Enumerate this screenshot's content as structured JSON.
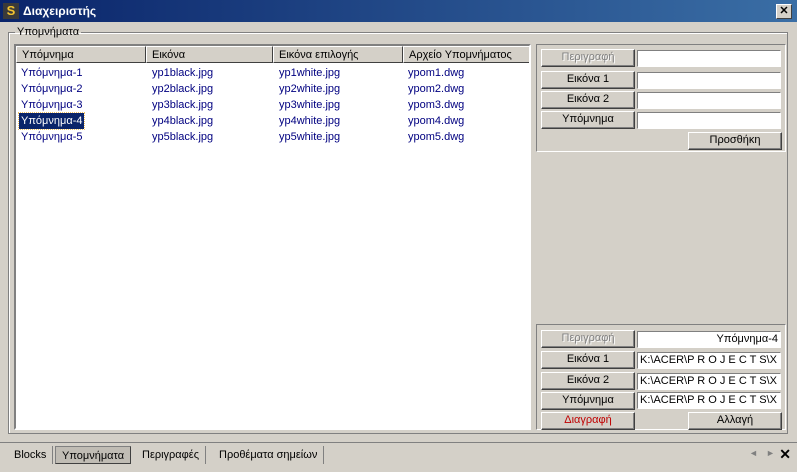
{
  "window": {
    "title": "Διαχειριστής",
    "close_glyph": "✕"
  },
  "group": {
    "legend": "Υπομνήματα"
  },
  "list": {
    "columns": [
      "Υπόμνημα",
      "Εικόνα",
      "Εικόνα επιλογής",
      "Αρχείο Υπομνήματος"
    ],
    "rows": [
      [
        "Υπόμνημα-1",
        "yp1black.jpg",
        "yp1white.jpg",
        "ypom1.dwg"
      ],
      [
        "Υπόμνημα-2",
        "yp2black.jpg",
        "yp2white.jpg",
        "ypom2.dwg"
      ],
      [
        "Υπόμνημα-3",
        "yp3black.jpg",
        "yp3white.jpg",
        "ypom3.dwg"
      ],
      [
        "Υπόμνημα-4",
        "yp4black.jpg",
        "yp4white.jpg",
        "ypom4.dwg"
      ],
      [
        "Υπόμνημα-5",
        "yp5black.jpg",
        "yp5white.jpg",
        "ypom5.dwg"
      ]
    ],
    "selected_label": "Υπόμνημα-4"
  },
  "add_panel": {
    "description_label": "Περιγραφή",
    "image1_label": "Εικόνα 1",
    "image2_label": "Εικόνα 2",
    "legend_label": "Υπόμνημα",
    "description_value": "",
    "image1_value": "",
    "image2_value": "",
    "legend_value": "",
    "add_button": "Προσθήκη"
  },
  "edit_panel": {
    "description_label": "Περιγραφή",
    "image1_label": "Εικόνα 1",
    "image2_label": "Εικόνα 2",
    "legend_label": "Υπόμνημα",
    "description_value": "Υπόμνημα-4",
    "image1_value": "K:\\ACER\\P R O J E C T S\\X",
    "image2_value": "K:\\ACER\\P R O J E C T S\\X",
    "legend_value": "K:\\ACER\\P R O J E C T S\\X",
    "delete_button": "Διαγραφή",
    "change_button": "Αλλαγή"
  },
  "tabs": {
    "items": [
      "Blocks",
      "Υπομνήματα",
      "Περιγραφές",
      "Προθέματα σημείων"
    ],
    "active": "Υπομνήματα",
    "prev_glyph": "◄",
    "next_glyph": "►",
    "close_glyph": "✕"
  },
  "colors": {
    "titlebar": "#0a246a",
    "selection": "#0a246a",
    "list_text": "#000080",
    "delete_text": "#c00000"
  }
}
